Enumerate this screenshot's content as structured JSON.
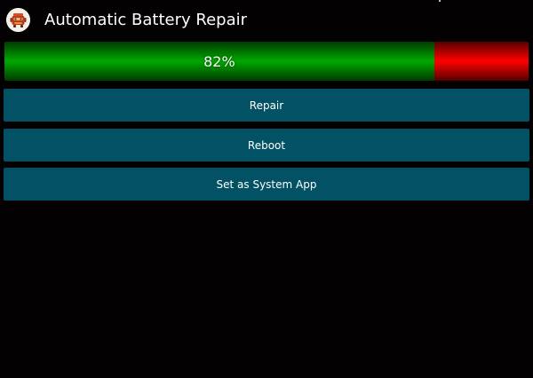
{
  "app": {
    "title": "Automatic Battery Repair",
    "icon": "battery-robot-icon"
  },
  "battery": {
    "label": "82%",
    "level_percent": 82,
    "fill_color": "#00a800",
    "empty_color": "#ff0000"
  },
  "actions": {
    "repair_label": "Repair",
    "reboot_label": "Reboot",
    "system_app_label": "Set as System App",
    "button_color": "#025164"
  },
  "theme": {
    "background": "#040102",
    "text": "#ffffff"
  }
}
